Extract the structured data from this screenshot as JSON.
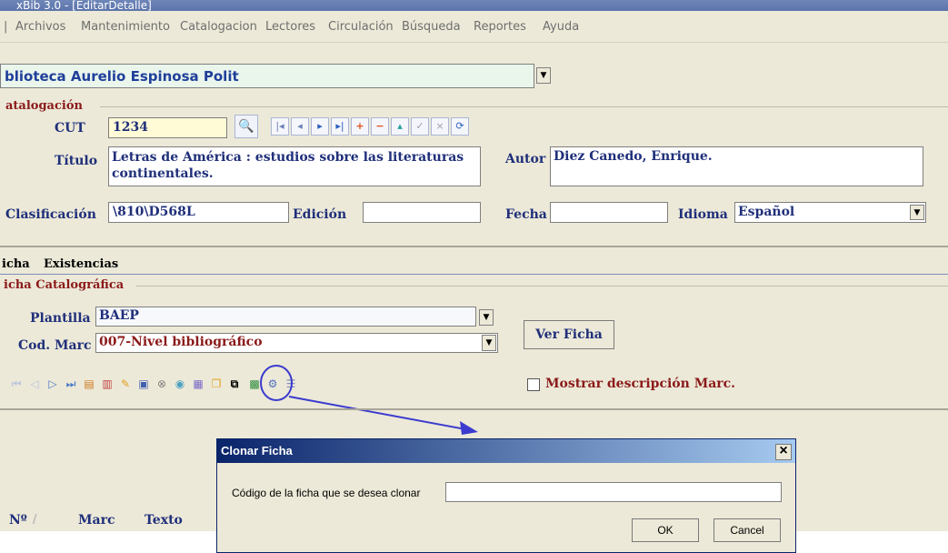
{
  "window": {
    "title": "xBib 3.0 - [EditarDetalle]"
  },
  "menu": [
    "Archivos",
    "Mantenimiento",
    "Catalogacion",
    "Lectores",
    "Circulación",
    "Búsqueda",
    "Reportes",
    "Ayuda"
  ],
  "library": {
    "selected": "blioteca Aurelio Espinosa Polit"
  },
  "catalog": {
    "section_title": "atalogación",
    "cut_label": "CUT",
    "cut_value": "1234",
    "titulo_label": "Título",
    "titulo_value": "Letras de América : estudios sobre las literaturas continentales.",
    "autor_label": "Autor",
    "autor_value": "Diez Canedo, Enrique.",
    "clasificacion_label": "Clasificación",
    "clasificacion_value": "\\810\\D568L",
    "edicion_label": "Edición",
    "edicion_value": "",
    "fecha_label": "Fecha",
    "fecha_value": "",
    "idioma_label": "Idioma",
    "idioma_value": "Español"
  },
  "tabs": {
    "ficha": "icha",
    "existencias": "Existencias"
  },
  "ficha": {
    "section_title": "icha Catalográfica",
    "plantilla_label": "Plantilla",
    "plantilla_value": "BAEP",
    "codmarc_label": "Cod. Marc",
    "codmarc_value": "007-Nivel bibliográfico",
    "ver_ficha": "Ver Ficha",
    "mostrar_desc": "Mostrar descripción Marc."
  },
  "grid": {
    "col_no": "Nº",
    "col_marc": "Marc",
    "col_texto": "Texto"
  },
  "dialog": {
    "title": "Clonar Ficha",
    "prompt": "Código de la ficha que se desea clonar",
    "input_value": "",
    "ok": "OK",
    "cancel": "Cancel",
    "close": "×"
  },
  "colors": {
    "label_blue": "#1f2f7a",
    "section_red": "#8b1a1a",
    "annotation": "#3b3bcf"
  }
}
